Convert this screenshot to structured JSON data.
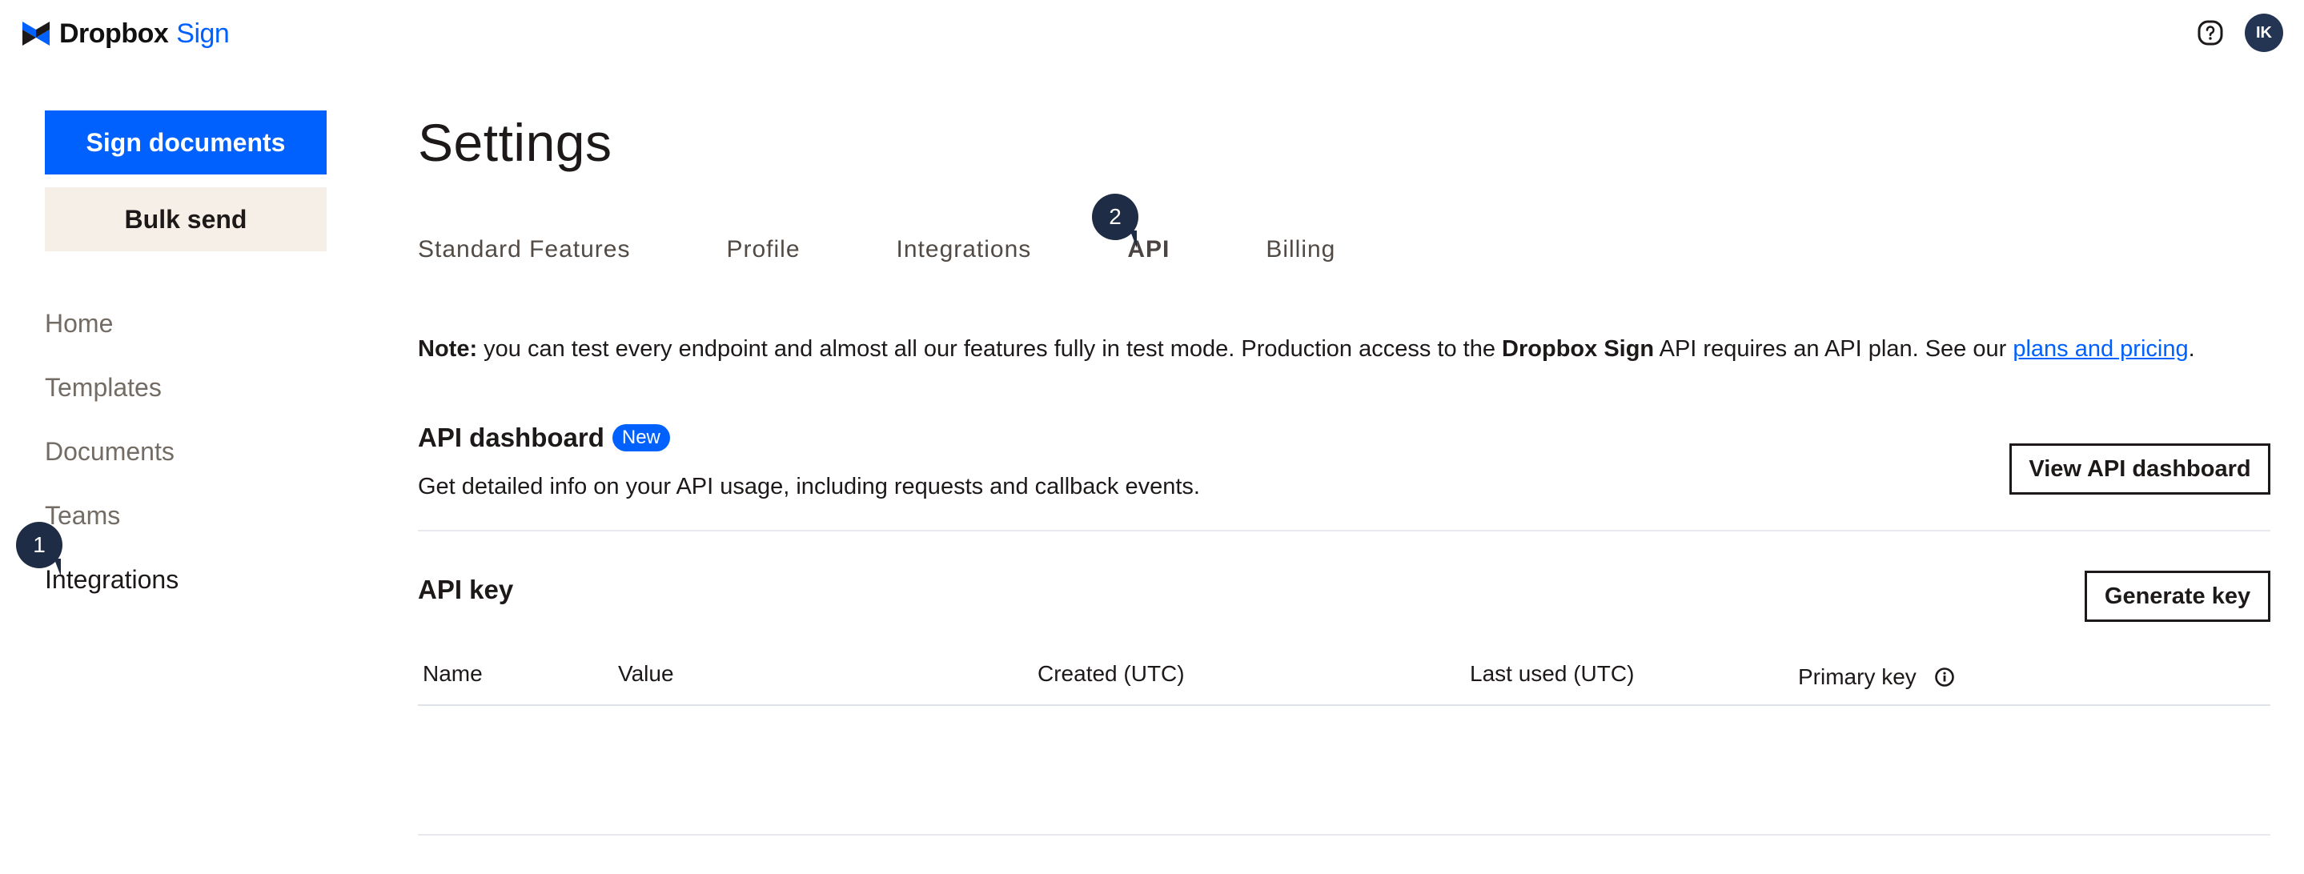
{
  "header": {
    "logo_brand": "Dropbox",
    "logo_product": "Sign",
    "help_icon": "help-circle-icon",
    "avatar_initials": "IK"
  },
  "sidebar": {
    "primary_button": "Sign documents",
    "secondary_button": "Bulk send",
    "items": [
      {
        "label": "Home",
        "active": false
      },
      {
        "label": "Templates",
        "active": false
      },
      {
        "label": "Documents",
        "active": false
      },
      {
        "label": "Teams",
        "active": false
      },
      {
        "label": "Integrations",
        "active": true
      }
    ]
  },
  "annotations": {
    "step1": "1",
    "step2": "2"
  },
  "main": {
    "title": "Settings",
    "tabs": [
      {
        "label": "Standard Features",
        "active": false
      },
      {
        "label": "Profile",
        "active": false
      },
      {
        "label": "Integrations",
        "active": false
      },
      {
        "label": "API",
        "active": true
      },
      {
        "label": "Billing",
        "active": false
      }
    ],
    "note": {
      "label": "Note:",
      "text1": " you can test every endpoint and almost all our features fully in test mode. Production access to the ",
      "brand": "Dropbox Sign",
      "text2": " API requires an API plan. See our ",
      "link": "plans and pricing",
      "text3": "."
    },
    "api_dashboard": {
      "title": "API dashboard",
      "badge": "New",
      "description": "Get detailed info on your API usage, including requests and callback events.",
      "button": "View API dashboard"
    },
    "api_key": {
      "title": "API key",
      "button": "Generate key",
      "columns": [
        "Name",
        "Value",
        "Created (UTC)",
        "Last used (UTC)",
        "Primary key"
      ],
      "rows": []
    }
  },
  "colors": {
    "brand_blue": "#0061fe",
    "bulk_send_bg": "#f5efe8",
    "avatar_bg": "#233552",
    "annotation_bg": "#1e2d45",
    "nav_inactive": "#736c64"
  }
}
